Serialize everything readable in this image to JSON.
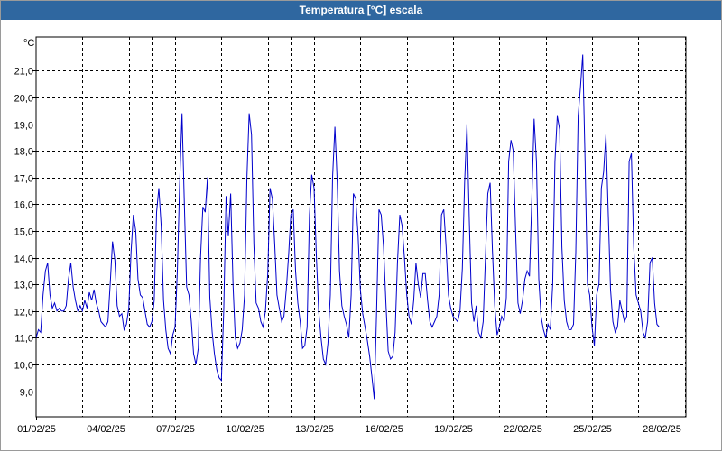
{
  "window": {
    "title": "Temperatura [°C] escala"
  },
  "chart_data": {
    "type": "line",
    "title": "Temperatura [°C] escala",
    "ylabel": "°C",
    "xlabel": "",
    "ylim": [
      8.2,
      22.5
    ],
    "xlim": [
      0,
      29
    ],
    "grid": true,
    "x_unit": "days since 01/02/25",
    "yticks": [
      "9,0",
      "10,0",
      "11,0",
      "12,0",
      "13,0",
      "14,0",
      "15,0",
      "16,0",
      "17,0",
      "18,0",
      "19,0",
      "20,0",
      "21,0"
    ],
    "ytick_values": [
      9,
      10,
      11,
      12,
      13,
      14,
      15,
      16,
      17,
      18,
      19,
      20,
      21
    ],
    "xticks": [
      "01/02/25",
      "04/02/25",
      "07/02/25",
      "10/02/25",
      "13/02/25",
      "16/02/25",
      "19/02/25",
      "22/02/25",
      "25/02/25",
      "28/02/25"
    ],
    "xtick_values": [
      0,
      3,
      6,
      9,
      12,
      15,
      18,
      21,
      24,
      27
    ],
    "series": [
      {
        "name": "Temperatura",
        "color": "#0000cc",
        "points": [
          [
            0.0,
            11.0
          ],
          [
            0.1,
            11.3
          ],
          [
            0.2,
            11.2
          ],
          [
            0.3,
            12.6
          ],
          [
            0.4,
            13.5
          ],
          [
            0.5,
            13.8
          ],
          [
            0.6,
            12.6
          ],
          [
            0.7,
            12.1
          ],
          [
            0.8,
            12.3
          ],
          [
            0.9,
            12.0
          ],
          [
            1.0,
            12.1
          ],
          [
            1.1,
            12.0
          ],
          [
            1.2,
            12.0
          ],
          [
            1.3,
            12.2
          ],
          [
            1.4,
            13.2
          ],
          [
            1.5,
            13.8
          ],
          [
            1.6,
            12.9
          ],
          [
            1.7,
            12.4
          ],
          [
            1.8,
            12.0
          ],
          [
            1.9,
            12.2
          ],
          [
            2.0,
            12.0
          ],
          [
            2.1,
            12.4
          ],
          [
            2.2,
            12.1
          ],
          [
            2.3,
            12.7
          ],
          [
            2.4,
            12.4
          ],
          [
            2.5,
            12.8
          ],
          [
            2.6,
            12.3
          ],
          [
            2.7,
            12.0
          ],
          [
            2.8,
            11.6
          ],
          [
            2.9,
            11.5
          ],
          [
            3.0,
            11.4
          ],
          [
            3.1,
            11.6
          ],
          [
            3.2,
            13.0
          ],
          [
            3.3,
            14.6
          ],
          [
            3.4,
            13.9
          ],
          [
            3.5,
            12.2
          ],
          [
            3.6,
            11.8
          ],
          [
            3.7,
            11.9
          ],
          [
            3.8,
            11.3
          ],
          [
            3.9,
            11.5
          ],
          [
            4.0,
            12.1
          ],
          [
            4.1,
            14.2
          ],
          [
            4.2,
            15.6
          ],
          [
            4.3,
            15.0
          ],
          [
            4.4,
            13.2
          ],
          [
            4.5,
            12.6
          ],
          [
            4.6,
            12.5
          ],
          [
            4.7,
            12.0
          ],
          [
            4.8,
            11.5
          ],
          [
            4.9,
            11.4
          ],
          [
            5.0,
            11.6
          ],
          [
            5.1,
            12.4
          ],
          [
            5.2,
            15.7
          ],
          [
            5.3,
            16.6
          ],
          [
            5.4,
            15.2
          ],
          [
            5.5,
            12.4
          ],
          [
            5.6,
            11.3
          ],
          [
            5.7,
            10.6
          ],
          [
            5.8,
            10.4
          ],
          [
            5.9,
            11.1
          ],
          [
            6.0,
            11.4
          ],
          [
            6.1,
            13.6
          ],
          [
            6.2,
            16.8
          ],
          [
            6.3,
            19.4
          ],
          [
            6.4,
            16.0
          ],
          [
            6.5,
            12.9
          ],
          [
            6.6,
            12.6
          ],
          [
            6.7,
            11.6
          ],
          [
            6.8,
            10.4
          ],
          [
            6.9,
            10.0
          ],
          [
            7.0,
            10.6
          ],
          [
            7.1,
            14.0
          ],
          [
            7.2,
            15.9
          ],
          [
            7.3,
            15.7
          ],
          [
            7.4,
            17.0
          ],
          [
            7.5,
            12.5
          ],
          [
            7.6,
            11.2
          ],
          [
            7.7,
            10.4
          ],
          [
            7.8,
            9.8
          ],
          [
            7.9,
            9.5
          ],
          [
            8.0,
            9.4
          ],
          [
            8.1,
            12.0
          ],
          [
            8.2,
            16.3
          ],
          [
            8.3,
            14.8
          ],
          [
            8.4,
            16.4
          ],
          [
            8.5,
            13.0
          ],
          [
            8.6,
            11.0
          ],
          [
            8.7,
            10.6
          ],
          [
            8.8,
            10.8
          ],
          [
            8.9,
            11.3
          ],
          [
            9.0,
            12.6
          ],
          [
            9.1,
            17.0
          ],
          [
            9.2,
            19.4
          ],
          [
            9.3,
            18.6
          ],
          [
            9.4,
            14.5
          ],
          [
            9.5,
            12.3
          ],
          [
            9.6,
            12.1
          ],
          [
            9.7,
            11.6
          ],
          [
            9.8,
            11.4
          ],
          [
            9.9,
            12.0
          ],
          [
            10.0,
            13.4
          ],
          [
            10.1,
            16.6
          ],
          [
            10.2,
            16.2
          ],
          [
            10.3,
            14.5
          ],
          [
            10.4,
            12.6
          ],
          [
            10.5,
            12.1
          ],
          [
            10.6,
            11.6
          ],
          [
            10.7,
            11.8
          ],
          [
            10.8,
            12.8
          ],
          [
            10.9,
            14.1
          ],
          [
            11.0,
            15.6
          ],
          [
            11.1,
            15.8
          ],
          [
            11.2,
            13.5
          ],
          [
            11.3,
            12.3
          ],
          [
            11.4,
            11.6
          ],
          [
            11.5,
            10.6
          ],
          [
            11.6,
            10.7
          ],
          [
            11.7,
            11.4
          ],
          [
            11.8,
            15.6
          ],
          [
            11.9,
            17.1
          ],
          [
            12.0,
            16.6
          ],
          [
            12.1,
            14.0
          ],
          [
            12.2,
            12.0
          ],
          [
            12.3,
            11.0
          ],
          [
            12.4,
            10.2
          ],
          [
            12.5,
            10.0
          ],
          [
            12.6,
            10.8
          ],
          [
            12.7,
            12.6
          ],
          [
            12.8,
            17.0
          ],
          [
            12.9,
            18.9
          ],
          [
            13.0,
            16.8
          ],
          [
            13.1,
            13.5
          ],
          [
            13.2,
            12.2
          ],
          [
            13.3,
            11.8
          ],
          [
            13.4,
            11.5
          ],
          [
            13.5,
            11.0
          ],
          [
            13.6,
            12.6
          ],
          [
            13.7,
            16.4
          ],
          [
            13.8,
            16.2
          ],
          [
            13.9,
            14.8
          ],
          [
            14.0,
            12.8
          ],
          [
            14.1,
            11.9
          ],
          [
            14.2,
            11.4
          ],
          [
            14.3,
            10.9
          ],
          [
            14.4,
            10.3
          ],
          [
            14.5,
            9.5
          ],
          [
            14.6,
            8.7
          ],
          [
            14.7,
            12.0
          ],
          [
            14.8,
            15.8
          ],
          [
            14.9,
            15.6
          ],
          [
            15.0,
            14.4
          ],
          [
            15.1,
            12.3
          ],
          [
            15.2,
            10.5
          ],
          [
            15.3,
            10.2
          ],
          [
            15.4,
            10.3
          ],
          [
            15.5,
            11.2
          ],
          [
            15.6,
            13.8
          ],
          [
            15.7,
            15.6
          ],
          [
            15.8,
            15.2
          ],
          [
            15.9,
            14.0
          ],
          [
            16.0,
            12.6
          ],
          [
            16.1,
            11.8
          ],
          [
            16.2,
            11.5
          ],
          [
            16.3,
            12.4
          ],
          [
            16.4,
            13.8
          ],
          [
            16.5,
            13.0
          ],
          [
            16.6,
            12.5
          ],
          [
            16.7,
            13.4
          ],
          [
            16.8,
            13.4
          ],
          [
            16.9,
            12.4
          ],
          [
            17.0,
            11.6
          ],
          [
            17.1,
            11.4
          ],
          [
            17.2,
            11.6
          ],
          [
            17.3,
            11.8
          ],
          [
            17.4,
            12.6
          ],
          [
            17.5,
            15.6
          ],
          [
            17.6,
            15.8
          ],
          [
            17.7,
            14.4
          ],
          [
            17.8,
            12.6
          ],
          [
            17.9,
            12.1
          ],
          [
            18.0,
            11.8
          ],
          [
            18.1,
            11.7
          ],
          [
            18.2,
            11.6
          ],
          [
            18.3,
            12.0
          ],
          [
            18.4,
            13.6
          ],
          [
            18.5,
            16.8
          ],
          [
            18.6,
            19.0
          ],
          [
            18.7,
            15.4
          ],
          [
            18.8,
            12.3
          ],
          [
            18.9,
            11.6
          ],
          [
            19.0,
            12.2
          ],
          [
            19.1,
            11.2
          ],
          [
            19.2,
            11.0
          ],
          [
            19.3,
            11.6
          ],
          [
            19.4,
            14.0
          ],
          [
            19.5,
            16.4
          ],
          [
            19.6,
            16.8
          ],
          [
            19.7,
            14.3
          ],
          [
            19.8,
            12.2
          ],
          [
            19.9,
            11.1
          ],
          [
            20.0,
            11.4
          ],
          [
            20.1,
            11.8
          ],
          [
            20.2,
            11.6
          ],
          [
            20.3,
            12.5
          ],
          [
            20.4,
            17.6
          ],
          [
            20.5,
            18.4
          ],
          [
            20.6,
            18.0
          ],
          [
            20.7,
            15.0
          ],
          [
            20.8,
            12.3
          ],
          [
            20.9,
            11.9
          ],
          [
            21.0,
            12.4
          ],
          [
            21.1,
            13.2
          ],
          [
            21.2,
            13.5
          ],
          [
            21.3,
            13.3
          ],
          [
            21.4,
            16.2
          ],
          [
            21.5,
            19.2
          ],
          [
            21.6,
            17.6
          ],
          [
            21.7,
            13.2
          ],
          [
            21.8,
            11.8
          ],
          [
            21.9,
            11.3
          ],
          [
            22.0,
            11.0
          ],
          [
            22.1,
            11.5
          ],
          [
            22.2,
            11.3
          ],
          [
            22.3,
            13.0
          ],
          [
            22.4,
            17.6
          ],
          [
            22.5,
            19.3
          ],
          [
            22.6,
            18.8
          ],
          [
            22.7,
            14.4
          ],
          [
            22.8,
            12.4
          ],
          [
            22.9,
            11.6
          ],
          [
            23.0,
            11.3
          ],
          [
            23.1,
            11.3
          ],
          [
            23.2,
            11.5
          ],
          [
            23.3,
            14.2
          ],
          [
            23.4,
            19.3
          ],
          [
            23.5,
            20.4
          ],
          [
            23.6,
            21.6
          ],
          [
            23.7,
            17.6
          ],
          [
            23.8,
            13.0
          ],
          [
            23.9,
            12.6
          ],
          [
            24.0,
            11.4
          ],
          [
            24.1,
            10.7
          ],
          [
            24.2,
            12.6
          ],
          [
            24.3,
            13.0
          ],
          [
            24.4,
            16.6
          ],
          [
            24.5,
            17.2
          ],
          [
            24.6,
            18.6
          ],
          [
            24.7,
            15.6
          ],
          [
            24.8,
            12.8
          ],
          [
            24.9,
            11.6
          ],
          [
            25.0,
            11.2
          ],
          [
            25.1,
            11.4
          ],
          [
            25.2,
            12.4
          ],
          [
            25.3,
            12.0
          ],
          [
            25.4,
            11.6
          ],
          [
            25.5,
            11.8
          ],
          [
            25.6,
            17.6
          ],
          [
            25.7,
            17.9
          ],
          [
            25.8,
            14.4
          ],
          [
            25.9,
            12.6
          ],
          [
            26.0,
            12.3
          ],
          [
            26.1,
            12.0
          ],
          [
            26.2,
            11.2
          ],
          [
            26.3,
            11.0
          ],
          [
            26.4,
            11.6
          ],
          [
            26.5,
            13.8
          ],
          [
            26.6,
            14.0
          ],
          [
            26.7,
            12.3
          ],
          [
            26.8,
            11.5
          ],
          [
            26.9,
            11.4
          ]
        ]
      }
    ]
  }
}
